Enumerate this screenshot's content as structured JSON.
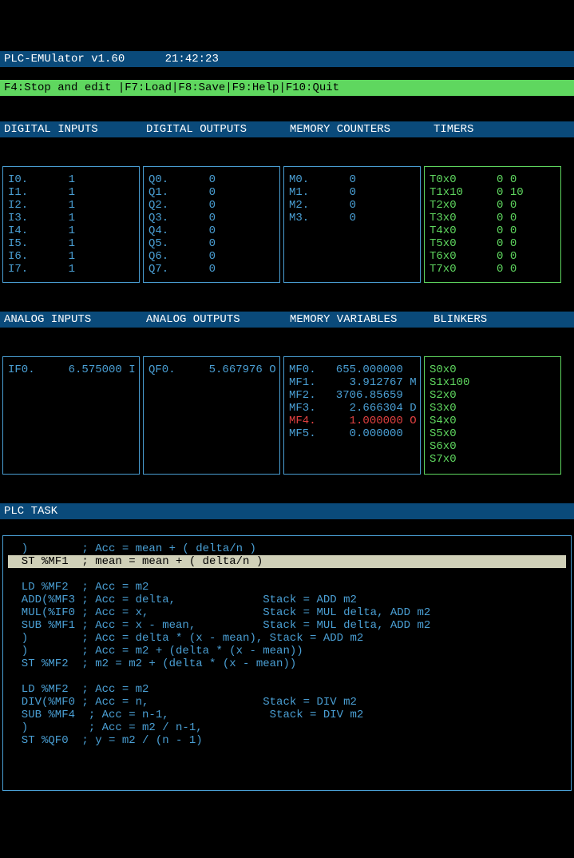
{
  "title": "PLC-EMUlator v1.60      21:42:23",
  "fnbar": "F4:Stop and edit |F7:Load|F8:Save|F9:Help|F10:Quit",
  "headers": {
    "di": "DIGITAL INPUTS",
    "do": "DIGITAL OUTPUTS",
    "mc": "MEMORY COUNTERS",
    "t": "TIMERS"
  },
  "headers2": {
    "ai": "ANALOG INPUTS",
    "ao": "ANALOG OUTPUTS",
    "mv": "MEMORY VARIABLES",
    "b": "BLINKERS"
  },
  "di": [
    {
      "n": "I0.",
      "v": "1"
    },
    {
      "n": "I1.",
      "v": "1"
    },
    {
      "n": "I2.",
      "v": "1"
    },
    {
      "n": "I3.",
      "v": "1"
    },
    {
      "n": "I4.",
      "v": "1"
    },
    {
      "n": "I5.",
      "v": "1"
    },
    {
      "n": "I6.",
      "v": "1"
    },
    {
      "n": "I7.",
      "v": "1"
    }
  ],
  "do_": [
    {
      "n": "Q0.",
      "v": "0"
    },
    {
      "n": "Q1.",
      "v": "0"
    },
    {
      "n": "Q2.",
      "v": "0"
    },
    {
      "n": "Q3.",
      "v": "0"
    },
    {
      "n": "Q4.",
      "v": "0"
    },
    {
      "n": "Q5.",
      "v": "0"
    },
    {
      "n": "Q6.",
      "v": "0"
    },
    {
      "n": "Q7.",
      "v": "0"
    }
  ],
  "mc": [
    {
      "n": "M0.",
      "v": "0"
    },
    {
      "n": "M1.",
      "v": "0"
    },
    {
      "n": "M2.",
      "v": "0"
    },
    {
      "n": "M3.",
      "v": "0"
    }
  ],
  "timers": [
    {
      "n": "T0x0",
      "a": "0",
      "b": "0"
    },
    {
      "n": "T1x10",
      "a": "0",
      "b": "10"
    },
    {
      "n": "T2x0",
      "a": "0",
      "b": "0"
    },
    {
      "n": "T3x0",
      "a": "0",
      "b": "0"
    },
    {
      "n": "T4x0",
      "a": "0",
      "b": "0"
    },
    {
      "n": "T5x0",
      "a": "0",
      "b": "0"
    },
    {
      "n": "T6x0",
      "a": "0",
      "b": "0"
    },
    {
      "n": "T7x0",
      "a": "0",
      "b": "0"
    }
  ],
  "ai": [
    {
      "n": "IF0.",
      "v": "6.575000",
      "s": "I"
    }
  ],
  "ao": [
    {
      "n": "QF0.",
      "v": "5.667976",
      "s": "O"
    }
  ],
  "mv": [
    {
      "n": "MF0.",
      "v": "655.000000",
      "s": ""
    },
    {
      "n": "MF1.",
      "v": "3.912767",
      "s": "M"
    },
    {
      "n": "MF2.",
      "v": "3706.85659",
      "s": ""
    },
    {
      "n": "MF3.",
      "v": "2.666304",
      "s": "D"
    },
    {
      "n": "MF4.",
      "v": "1.000000",
      "s": "O",
      "red": true
    },
    {
      "n": "MF5.",
      "v": "0.000000",
      "s": ""
    }
  ],
  "blinkers": [
    "S0x0",
    "S1x100",
    "S2x0",
    "S3x0",
    "S4x0",
    "S5x0",
    "S6x0",
    "S7x0"
  ],
  "task_header": "PLC TASK",
  "code": [
    {
      "t": "  )        ; Acc = mean + ( delta/n )"
    },
    {
      "t": "  ST %MF1  ; mean = mean + ( delta/n )",
      "hl": true
    },
    {
      "t": ""
    },
    {
      "t": "  LD %MF2  ; Acc = m2"
    },
    {
      "t": "  ADD(%MF3 ; Acc = delta,             Stack = ADD m2"
    },
    {
      "t": "  MUL(%IF0 ; Acc = x,                 Stack = MUL delta, ADD m2"
    },
    {
      "t": "  SUB %MF1 ; Acc = x - mean,          Stack = MUL delta, ADD m2"
    },
    {
      "t": "  )        ; Acc = delta * (x - mean), Stack = ADD m2"
    },
    {
      "t": "  )        ; Acc = m2 + (delta * (x - mean))"
    },
    {
      "t": "  ST %MF2  ; m2 = m2 + (delta * (x - mean))"
    },
    {
      "t": ""
    },
    {
      "t": "  LD %MF2  ; Acc = m2"
    },
    {
      "t": "  DIV(%MF0 ; Acc = n,                 Stack = DIV m2"
    },
    {
      "t": "  SUB %MF4  ; Acc = n-1,               Stack = DIV m2"
    },
    {
      "t": "  )         ; Acc = m2 / n-1,"
    },
    {
      "t": "  ST %QF0  ; y = m2 / (n - 1)"
    }
  ]
}
